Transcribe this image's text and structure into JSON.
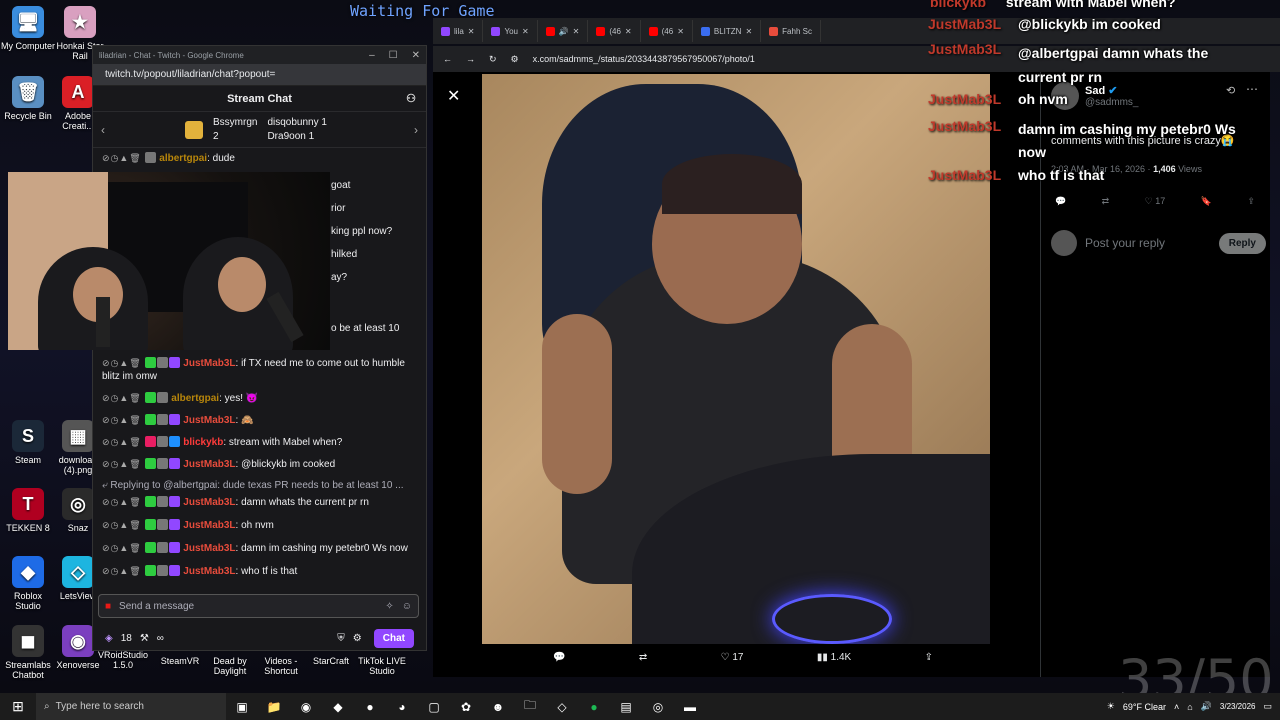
{
  "desktop_icons": [
    {
      "label": "My Computer",
      "color": "#3a8dde",
      "glyph": "🖥"
    },
    {
      "label": "Honkai Star Rail",
      "color": "#d9a0c0",
      "glyph": "★"
    },
    {
      "label": "Recycle Bin",
      "color": "#5a8fc2",
      "glyph": "🗑"
    },
    {
      "label": "Adobe Creati...",
      "color": "#da1f26",
      "glyph": "A"
    },
    {
      "label": "Steam",
      "color": "#1b2838",
      "glyph": "S"
    },
    {
      "label": "download (4).png",
      "color": "#555",
      "glyph": "▦"
    },
    {
      "label": "TEKKEN 8",
      "color": "#b00020",
      "glyph": "T"
    },
    {
      "label": "Snaz",
      "color": "#2a2a2a",
      "glyph": "◎"
    },
    {
      "label": "Roblox Studio",
      "color": "#1e6be6",
      "glyph": "◆"
    },
    {
      "label": "LetsView",
      "color": "#1db5e0",
      "glyph": "◇"
    },
    {
      "label": "Streamlabs Chatbot",
      "color": "#333",
      "glyph": "◼"
    },
    {
      "label": "Xenoverse",
      "color": "#7b3fbf",
      "glyph": "◉"
    },
    {
      "label": "VRoidStudio 1.5.0",
      "color": "#444",
      "glyph": "V"
    },
    {
      "label": "SteamVR",
      "color": "#1b2838",
      "glyph": "◐"
    },
    {
      "label": "Dead by Daylight",
      "color": "#222",
      "glyph": "D"
    },
    {
      "label": "Videos - Shortcut",
      "color": "#333",
      "glyph": "▶"
    },
    {
      "label": "StarCraft",
      "color": "#223",
      "glyph": "✦"
    },
    {
      "label": "TikTok LIVE Studio",
      "color": "#000",
      "glyph": "♪"
    }
  ],
  "overlay_waiting": "Waiting For Game",
  "twitch_window": {
    "title": "liladrian - Chat - Twitch - Google Chrome",
    "url": "twitch.tv/popout/liladrian/chat?popout=",
    "chat_title": "Stream Chat",
    "gifters": [
      {
        "name": "Bssymrgn",
        "count": "2"
      },
      {
        "name": "disqobunny",
        "count": "1"
      },
      {
        "name": "Dra9oon",
        "count": "1"
      }
    ],
    "partial_messages": [
      {
        "user": "albertgpai",
        "text": ": dude"
      },
      {
        "user": "",
        "text": "goat"
      },
      {
        "user": "",
        "text": "rior"
      },
      {
        "user": "",
        "text": "king ppl now?"
      },
      {
        "user": "",
        "text": "hilked"
      },
      {
        "user": "",
        "text": "ay?"
      },
      {
        "user": "",
        "text": "o be at least 10"
      }
    ],
    "messages": [
      {
        "user": "JustMab3L",
        "color": "#e74c3c",
        "text": ": if TX need me to come out to humble blitz im omw"
      },
      {
        "user": "albertgpai",
        "color": "#b8860b",
        "text": ": yes! 😈"
      },
      {
        "user": "JustMab3L",
        "color": "#e74c3c",
        "text": ": 🙈"
      },
      {
        "user": "blickykb",
        "color": "#ff3b3b",
        "text": ": stream with Mabel when?"
      },
      {
        "user": "JustMab3L",
        "color": "#e74c3c",
        "text": ": @blickykb im cooked"
      },
      {
        "user": "JustMab3L",
        "color": "#e74c3c",
        "text": ": damn whats the current pr rn",
        "reply": "Replying to @albertgpai: dude texas PR needs to be at least 10 ..."
      },
      {
        "user": "JustMab3L",
        "color": "#e74c3c",
        "text": ": oh nvm"
      },
      {
        "user": "JustMab3L",
        "color": "#e74c3c",
        "text": ": damn im cashing my petebr0 Ws now"
      },
      {
        "user": "JustMab3L",
        "color": "#e74c3c",
        "text": ": who tf is that"
      }
    ],
    "input_placeholder": "Send a message",
    "footer_count": "18",
    "footer_infinity": "∞",
    "chat_button": "Chat"
  },
  "browser": {
    "tabs": [
      {
        "label": "lila",
        "color": "#9147ff"
      },
      {
        "label": "You",
        "color": "#9147ff"
      },
      {
        "label": "",
        "color": "#ff0000"
      },
      {
        "label": "",
        "color": "#555"
      },
      {
        "label": "(46",
        "color": "#ff0000"
      },
      {
        "label": "(46",
        "color": "#ff0000"
      },
      {
        "label": "BLITZN",
        "color": "#3a6df0"
      },
      {
        "label": "Fahh Sc",
        "color": "#e74c3c"
      }
    ],
    "url": "x.com/sadmms_/status/2033443879567950067/photo/1"
  },
  "photo_actions": {
    "replies": "",
    "reposts": "",
    "likes": "17",
    "views": "1.4K"
  },
  "tweet": {
    "author": "Sad",
    "handle": "@sadmms_",
    "text": "comments with this picture is crazy😭",
    "time": "2:03 AM · Mar 16, 2026 · ",
    "views": "1,406",
    "views_label": " Views",
    "likes": "17",
    "reply_placeholder": "Post your reply",
    "reply_button": "Reply"
  },
  "overlay_chat": [
    {
      "user": "blickykb",
      "text": "stream with Mabel when?"
    },
    {
      "user": "JustMab3L",
      "text": "@blickykb im cooked"
    },
    {
      "user": "JustMab3L",
      "text": "@albertgpai damn whats the current pr rn"
    },
    {
      "user": "JustMab3L",
      "text": "oh nvm"
    },
    {
      "user": "JustMab3L",
      "text": "damn im cashing my petebr0 Ws now"
    },
    {
      "user": "JustMab3L",
      "text": "who tf is that"
    }
  ],
  "counter": "33/50",
  "taskbar": {
    "search_placeholder": "Type here to search",
    "weather": "69°F  Clear",
    "time": "",
    "date": "3/23/2026"
  }
}
